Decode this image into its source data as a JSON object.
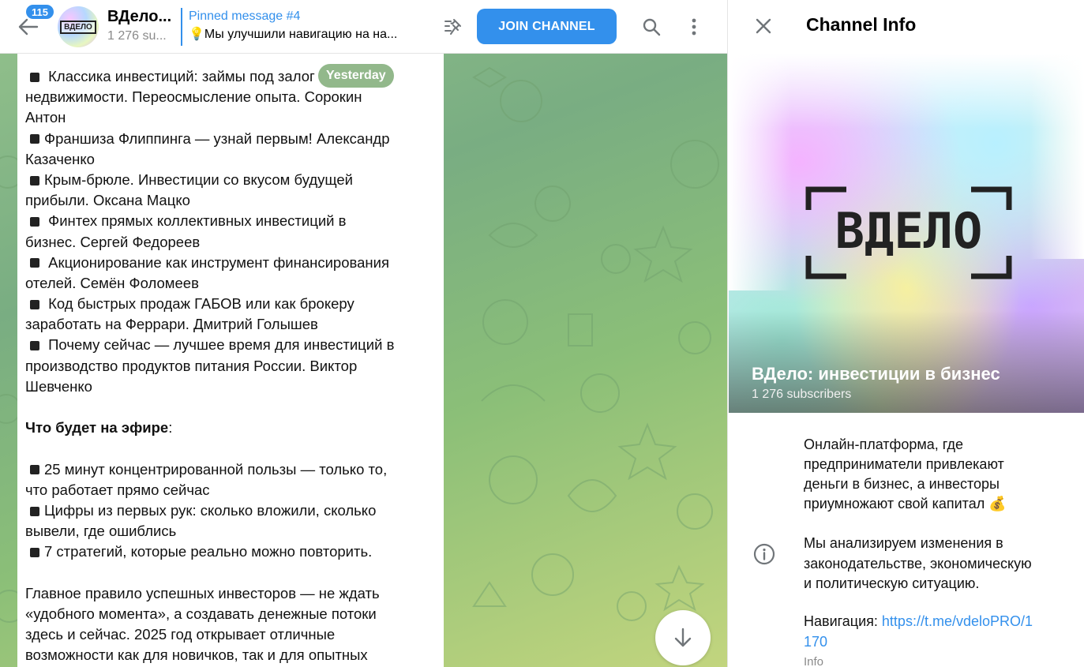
{
  "colors": {
    "accent": "#3390ec",
    "chat_bg_start": "#8fbe8a",
    "chat_bg_end": "#c2d57e"
  },
  "header": {
    "back_icon": "arrow-left-icon",
    "unread_count": "115",
    "chat_title": "ВДело...",
    "chat_subtitle": "1 276 su...",
    "pinned_title": "Pinned message #4",
    "pinned_text": "💡Мы улучшили навигацию на на...",
    "join_label": "JOIN CHANNEL",
    "avatar_label": "ВДЕЛО"
  },
  "chat": {
    "date_chip": "Yesterday",
    "message_lines": [
      {
        "bullet": true,
        "bold": false,
        "text": " Классика инвестиций: займы под залог"
      },
      {
        "bullet": false,
        "bold": false,
        "text": "недвижимости. Переосмысление опыта. Сорокин"
      },
      {
        "bullet": false,
        "bold": false,
        "text": "Антон"
      },
      {
        "bullet": true,
        "bold": false,
        "text": "Франшиза Флиппинга — узнай первым! Александр"
      },
      {
        "bullet": false,
        "bold": false,
        "text": "Казаченко"
      },
      {
        "bullet": true,
        "bold": false,
        "text": "Крым-брюле. Инвестиции со вкусом будущей"
      },
      {
        "bullet": false,
        "bold": false,
        "text": "прибыли. Оксана Мацко"
      },
      {
        "bullet": true,
        "bold": false,
        "text": " Финтех прямых коллективных инвестиций в"
      },
      {
        "bullet": false,
        "bold": false,
        "text": "бизнес. Сергей Федореев"
      },
      {
        "bullet": true,
        "bold": false,
        "text": " Акционирование как инструмент финансирования"
      },
      {
        "bullet": false,
        "bold": false,
        "text": "отелей. Семён Фоломеев"
      },
      {
        "bullet": true,
        "bold": false,
        "text": " Код быстрых продаж ГАБОВ или как брокеру"
      },
      {
        "bullet": false,
        "bold": false,
        "text": "заработать на Феррари. Дмитрий Голышев"
      },
      {
        "bullet": true,
        "bold": false,
        "text": " Почему сейчас — лучшее время для инвестиций в"
      },
      {
        "bullet": false,
        "bold": false,
        "text": "производство продуктов питания России. Виктор"
      },
      {
        "bullet": false,
        "bold": false,
        "text": "Шевченко"
      },
      {
        "bullet": false,
        "bold": false,
        "text": ""
      },
      {
        "bullet": false,
        "bold": true,
        "text": "Что будет на эфире",
        "suffix": ":"
      },
      {
        "bullet": false,
        "bold": false,
        "text": ""
      },
      {
        "bullet": true,
        "bold": false,
        "text": "25 минут концентрированной пользы — только то,"
      },
      {
        "bullet": false,
        "bold": false,
        "text": "что работает прямо сейчас"
      },
      {
        "bullet": true,
        "bold": false,
        "text": "Цифры из первых рук: сколько вложили, сколько"
      },
      {
        "bullet": false,
        "bold": false,
        "text": "вывели, где ошиблись"
      },
      {
        "bullet": true,
        "bold": false,
        "text": "7 стратегий, которые реально можно повторить."
      },
      {
        "bullet": false,
        "bold": false,
        "text": ""
      },
      {
        "bullet": false,
        "bold": false,
        "text": "Главное правило успешных инвесторов — не ждать"
      },
      {
        "bullet": false,
        "bold": false,
        "text": "«удобного момента», а создавать денежные потоки"
      },
      {
        "bullet": false,
        "bold": false,
        "text": "здесь и сейчас. 2025 год открывает отличные"
      },
      {
        "bullet": false,
        "bold": false,
        "text": "возможности как для новичков, так и для опытных"
      }
    ]
  },
  "info_panel": {
    "title": "Channel Info",
    "hero_logo_text": "ВДЕЛО",
    "channel_name": "ВДело: инвестиции в бизнес",
    "subscribers": "1 276 subscribers",
    "about_lines": [
      "Онлайн-платформа, где",
      "предприниматели привлекают",
      "деньги в бизнес, а инвесторы",
      "приумножают свой капитал 💰"
    ],
    "desc_lines": [
      "Мы анализируем изменения в",
      "законодательстве, экономическую",
      "и политическую ситуацию."
    ],
    "nav_label": "Навигация: ",
    "nav_link_line1": "https://t.me/vdeloPRO/1",
    "nav_link_line2": "170",
    "info_label": "Info"
  }
}
